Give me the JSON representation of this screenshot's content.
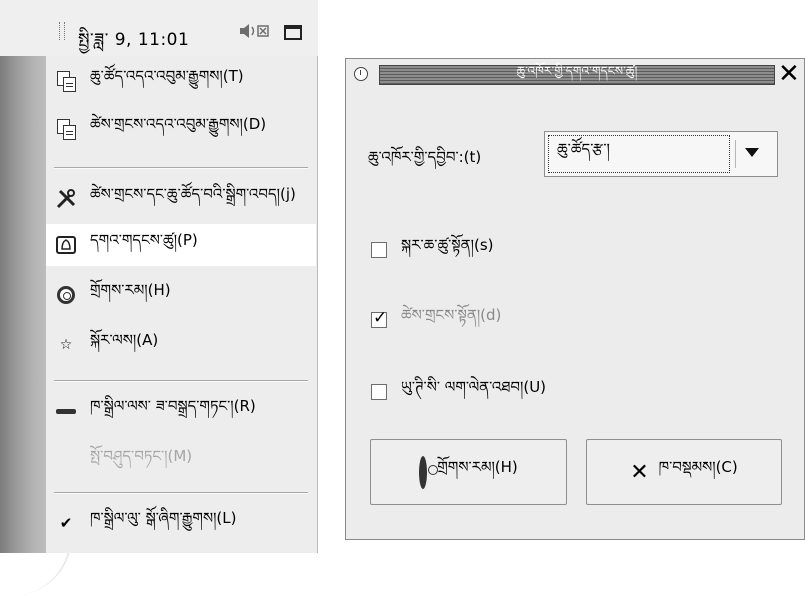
{
  "panel": {
    "clock_text": "སྤྱི་ཟླ་ 9, 11:01"
  },
  "menu": {
    "items": [
      {
        "label": "ཆུ་ཚོད་འདའ་འབུམ་རྒྱུགས།(T)",
        "icon": "copy-icon"
      },
      {
        "label": "ཚེས་གྲངས་འདའ་འབུམ་རྒྱུགས།(D)",
        "icon": "copy-icon"
      },
      {
        "label": "ཚེས་གྲངས་དང་ཆུ་ཚོད་བའི་སྒྲིག་འབད།(j)",
        "icon": "tools-icon"
      },
      {
        "label": "དགའ་གདངས་ཚུ།(P)",
        "icon": "preferences-icon"
      },
      {
        "label": "གྲོགས་རམ།(H)",
        "icon": "help-icon"
      },
      {
        "label": "སྐོར་ལས།(A)",
        "icon": "star-icon"
      },
      {
        "label": "ཁ་སྒྲིལ་ལས་ ཟ་བསྒྲད་གཏང་།(R)",
        "icon": "remove-icon"
      },
      {
        "label": "སྤོ་བཤུད་བཏང་།(M)",
        "icon": ""
      },
      {
        "label": "ཁ་སྒྲིལ་ལུ་ སྒོ་ཞིག་རྒྱུགས།(L)",
        "icon": "check-icon"
      }
    ]
  },
  "dialog": {
    "title": "ཆུ་འཁོར་གྱི་དགའ་གདངས་ཚུ།",
    "format_label": "ཆུ་འཁོར་གྱི་དབྱིབ་:(t)",
    "format_value": "ཆུ་ཚོད་རྩ་།",
    "checks": [
      {
        "label": "སྐར་ཆ་ཚུ་སྟོན།(s)",
        "checked": false,
        "dim": false
      },
      {
        "label": "ཚེས་གྲངས་སྟོན།(d)",
        "checked": true,
        "dim": true
      },
      {
        "label": "ཡུ་ཊི་སི་ ལག་ལེན་འཐབ།(U)",
        "checked": false,
        "dim": false
      }
    ],
    "help_button": "གྲོགས་རམ།(H)",
    "close_button": "ཁ་བསྡམས།(C)"
  }
}
